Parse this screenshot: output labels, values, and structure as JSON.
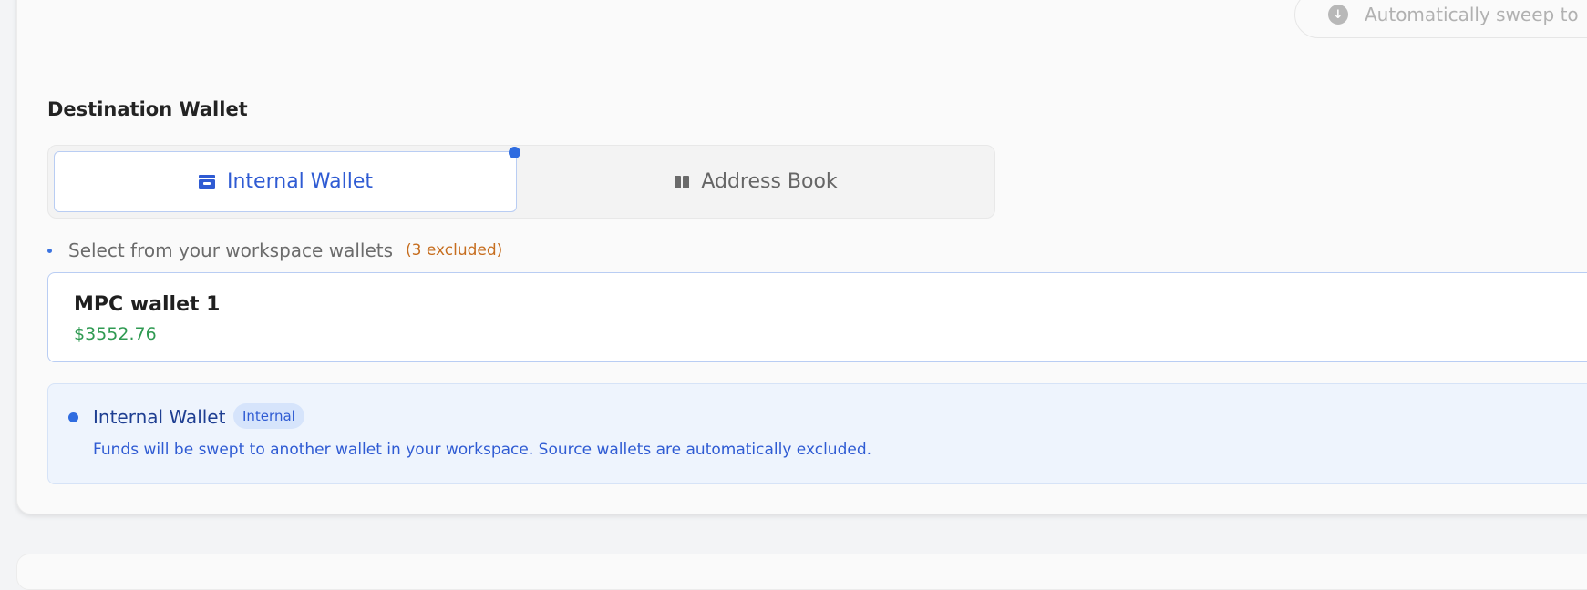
{
  "sweep": {
    "text": "Automatically sweep to",
    "icon": "arrow-down-circle-icon"
  },
  "destination": {
    "title": "Destination Wallet",
    "tabs": [
      {
        "label": "Internal Wallet",
        "icon": "wallet-icon",
        "selected": true
      },
      {
        "label": "Address Book",
        "icon": "book-icon",
        "selected": false
      }
    ],
    "hint": "Select from your workspace wallets",
    "excluded": "(3 excluded)"
  },
  "wallet": {
    "name": "MPC wallet 1",
    "balance": "$3552.76"
  },
  "info": {
    "title": "Internal Wallet",
    "badge": "Internal",
    "description": "Funds will be swept to another wallet in your workspace. Source wallets are automatically excluded."
  },
  "colors": {
    "accent": "#2f6ce0",
    "balance_green": "#2f9a52",
    "excluded_orange": "#c66d1e",
    "info_background": "#eef4fd"
  }
}
